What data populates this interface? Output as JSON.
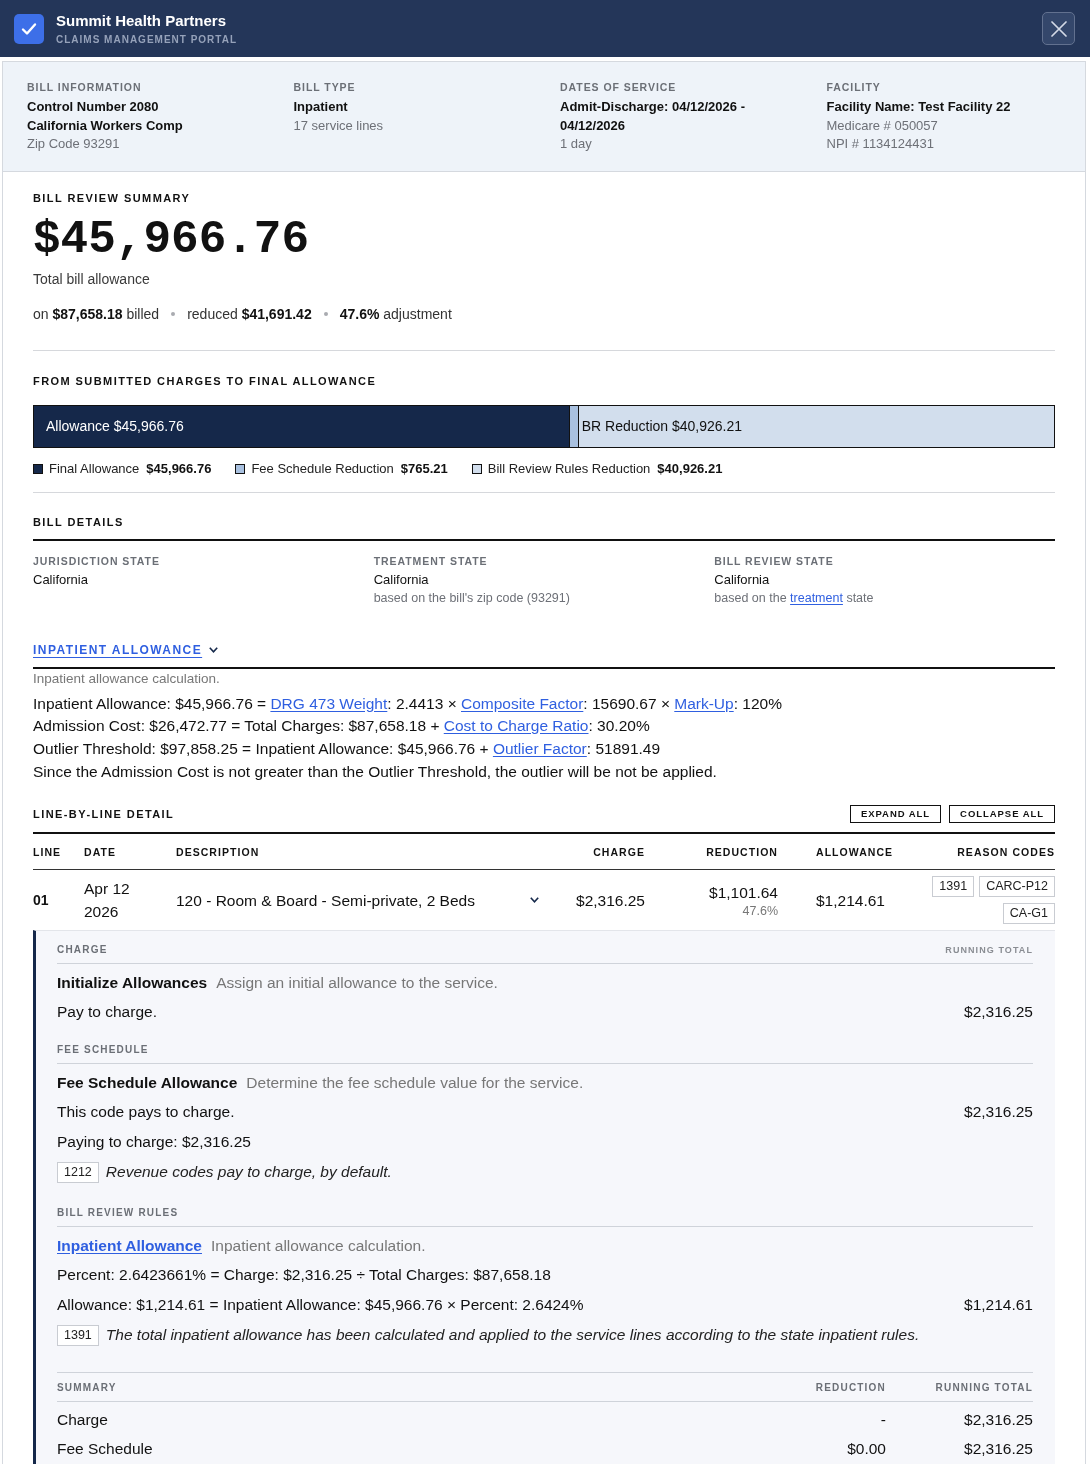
{
  "header": {
    "title": "Summit Health Partners",
    "subtitle": "CLAIMS MANAGEMENT PORTAL"
  },
  "bill_info": [
    {
      "label": "BILL INFORMATION",
      "lines": [
        {
          "text": "Control Number 2080",
          "kind": "strong"
        },
        {
          "text": "California Workers Comp",
          "kind": "strong"
        },
        {
          "text": "Zip Code 93291",
          "kind": "muted"
        }
      ]
    },
    {
      "label": "BILL TYPE",
      "lines": [
        {
          "text": "Inpatient",
          "kind": "strong"
        },
        {
          "text": "17 service lines",
          "kind": "muted"
        }
      ]
    },
    {
      "label": "DATES OF SERVICE",
      "lines": [
        {
          "text": "Admit-Discharge: 04/12/2026 - 04/12/2026",
          "kind": "strong"
        },
        {
          "text": "1 day",
          "kind": "muted"
        }
      ]
    },
    {
      "label": "FACILITY",
      "lines": [
        {
          "text": "Facility Name: Test Facility 22",
          "kind": "strong"
        },
        {
          "text": "Medicare # 050057",
          "kind": "muted"
        },
        {
          "text": "NPI # 1134124431",
          "kind": "muted"
        }
      ]
    }
  ],
  "summary": {
    "heading": "BILL REVIEW SUMMARY",
    "amount": "$45,966.76",
    "caption": "Total bill allowance",
    "stats": [
      "on **$87,658.18** billed",
      "reduced **$41,691.42**",
      "**47.6%** adjustment"
    ]
  },
  "breakdown": {
    "heading": "FROM SUBMITTED CHARGES TO FINAL ALLOWANCE",
    "segments": [
      {
        "label": "Allowance $45,966.76",
        "level": 0.5244,
        "color": "#15284a"
      },
      {
        "level": 0.0087,
        "color": "#a9c1e0"
      },
      {
        "label": "BR Reduction $40,926.21",
        "level": 0.4669,
        "color": "#d2deed"
      }
    ],
    "legend": [
      {
        "label": "Final Allowance",
        "value": "$45,966.76",
        "color": "#15284a"
      },
      {
        "label": "Fee Schedule Reduction",
        "value": "$765.21",
        "color": "#a9c1e0"
      },
      {
        "label": "Bill Review Rules Reduction",
        "value": "$40,926.21",
        "color": "#d2deed"
      }
    ]
  },
  "bill_details": {
    "heading": "BILL DETAILS",
    "items": [
      {
        "label": "JURISDICTION STATE",
        "value": "California"
      },
      {
        "label": "TREATMENT STATE",
        "value": "California",
        "note": [
          {
            "kind": "text",
            "text": "based on the bill's zip code (93291)"
          }
        ]
      },
      {
        "label": "BILL REVIEW STATE",
        "value": "California",
        "note": [
          {
            "kind": "text",
            "text": "based on the "
          },
          {
            "kind": "link",
            "text": "treatment"
          },
          {
            "kind": "text",
            "text": " state"
          }
        ]
      }
    ]
  },
  "inpatient": {
    "title": "INPATIENT ALLOWANCE",
    "expanded": true,
    "description": "Inpatient allowance calculation.",
    "lines": [
      [
        {
          "kind": "text",
          "text": "Inpatient Allowance: $45,966.76 = "
        },
        {
          "kind": "link",
          "text": "DRG 473 Weight"
        },
        {
          "kind": "text",
          "text": ": 2.4413 × "
        },
        {
          "kind": "link",
          "text": "Composite Factor"
        },
        {
          "kind": "text",
          "text": ": 15690.67 × "
        },
        {
          "kind": "link",
          "text": "Mark-Up"
        },
        {
          "kind": "text",
          "text": ": 120%"
        }
      ],
      [
        {
          "kind": "text",
          "text": "Admission Cost: $26,472.77 = Total Charges: $87,658.18 + "
        },
        {
          "kind": "link",
          "text": "Cost to Charge Ratio"
        },
        {
          "kind": "text",
          "text": ": 30.20%"
        }
      ],
      [
        {
          "kind": "text",
          "text": "Outlier Threshold: $97,858.25 = Inpatient Allowance: $45,966.76 + "
        },
        {
          "kind": "link",
          "text": "Outlier Factor"
        },
        {
          "kind": "text",
          "text": ": 51891.49"
        }
      ],
      [
        {
          "kind": "text",
          "text": "Since the Admission Cost is not greater than the Outlier Threshold, the outlier will be not be applied."
        }
      ]
    ]
  },
  "line_detail": {
    "heading": "LINE-BY-LINE DETAIL",
    "buttons": [
      "EXPAND ALL",
      "COLLAPSE ALL"
    ],
    "columns": [
      "LINE",
      "DATE",
      "DESCRIPTION",
      "CHARGE",
      "REDUCTION",
      "ALLOWANCE",
      "REASON CODES"
    ],
    "lines": [
      {
        "line": "01",
        "date": "Apr 12 2026",
        "description": "120 - Room & Board - Semi-private, 2 Beds",
        "charge": "$2,316.25",
        "reduction": "$1,101.64",
        "reduction_pct": "47.6%",
        "allowance": "$1,214.61",
        "reason_codes": [
          "1391",
          "CARC-P12",
          "CA-G1"
        ],
        "expanded": true,
        "detail": {
          "sections": [
            {
              "heading": "CHARGE",
              "aside": "RUNNING TOTAL",
              "steps": [
                {
                  "kind": "plain",
                  "title": "Initialize Allowances",
                  "description": "Assign an initial allowance to the service.",
                  "lines": [
                    {
                      "text": "Pay to charge.",
                      "amount": "$2,316.25"
                    }
                  ]
                }
              ]
            },
            {
              "heading": "FEE SCHEDULE",
              "steps": [
                {
                  "kind": "plain",
                  "title": "Fee Schedule Allowance",
                  "description": "Determine the fee schedule value for the service.",
                  "lines": [
                    {
                      "text": "This code pays to charge.",
                      "amount": "$2,316.25"
                    },
                    {
                      "text": "Paying to charge: $2,316.25"
                    }
                  ],
                  "notes": [
                    {
                      "code": "1212",
                      "text": "Revenue codes pay to charge, by default."
                    }
                  ]
                }
              ]
            },
            {
              "heading": "BILL REVIEW RULES",
              "steps": [
                {
                  "kind": "link",
                  "title": "Inpatient Allowance",
                  "description": "Inpatient allowance calculation.",
                  "lines": [
                    {
                      "text": "Percent: 2.6423661% = Charge: $2,316.25 ÷ Total Charges: $87,658.18"
                    },
                    {
                      "text": "Allowance: $1,214.61 = Inpatient Allowance: $45,966.76 × Percent: 2.6424%",
                      "amount": "$1,214.61"
                    }
                  ],
                  "notes": [
                    {
                      "code": "1391",
                      "text": "The total inpatient allowance has been calculated and applied to the service lines according to the state inpatient rules."
                    }
                  ]
                }
              ]
            }
          ],
          "summary": {
            "columns": [
              "SUMMARY",
              "REDUCTION",
              "RUNNING TOTAL"
            ],
            "rows": [
              [
                "Charge",
                "-",
                "$2,316.25"
              ],
              [
                "Fee Schedule",
                "$0.00",
                "$2,316.25"
              ]
            ]
          }
        }
      }
    ]
  }
}
